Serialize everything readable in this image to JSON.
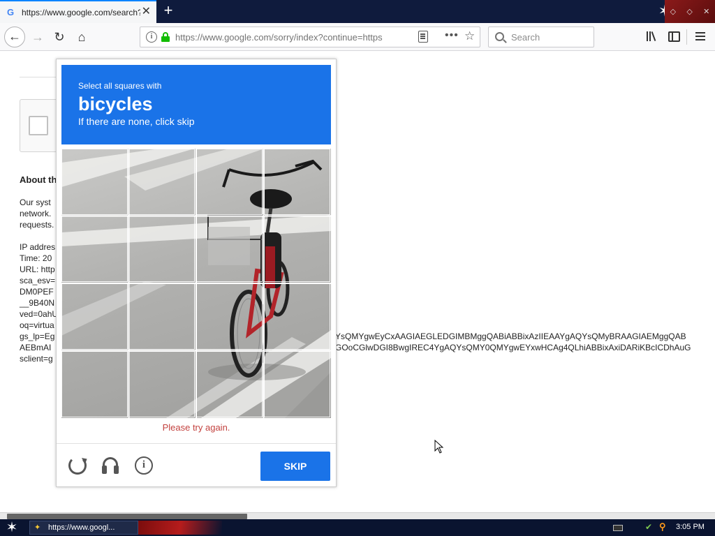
{
  "browser": {
    "tab": {
      "title": "https://www.google.com/search?",
      "favicon": "google-g-icon",
      "favicon_text": "G"
    },
    "toolbar": {
      "url": "https://www.google.com/sorry/index?continue=https",
      "search_placeholder": "Search"
    }
  },
  "page_background": {
    "about_heading": "About th",
    "lines_block1": [
      "Our syst",
      "network.",
      "requests."
    ],
    "lines_block2": [
      "IP addres",
      "Time: 20",
      "URL: http",
      "sca_esv=",
      "DM0PEF",
      "__9B40N",
      "ved=0ahU",
      "oq=virtua",
      "gs_lp=Eg",
      "AEBmAI",
      "sclient=g"
    ],
    "long_url_line1": "YsQMYgwEyCxAAGIAEGLEDGIMBMggQABiABBixAzIIEAAYgAQYsQMyBRAAGIAEMggQAB",
    "long_url_line2": "GOoCGlwDGI8BwgIREC4YgAQYsQMY0QMYgwEYxwHCAg4QLhiABBixAxiDARiKBcICDhAuG"
  },
  "captcha": {
    "instruction_small": "Select all squares with",
    "target_object": "bicycles",
    "instruction_sub": "If there are none, click skip",
    "grid_size": 4,
    "error_message": "Please try again.",
    "skip_label": "SKIP",
    "header_color": "#1a73e8",
    "error_color": "#c3423f"
  },
  "taskbar": {
    "task_label": "https://www.googl...",
    "clock": "3:05 PM"
  }
}
